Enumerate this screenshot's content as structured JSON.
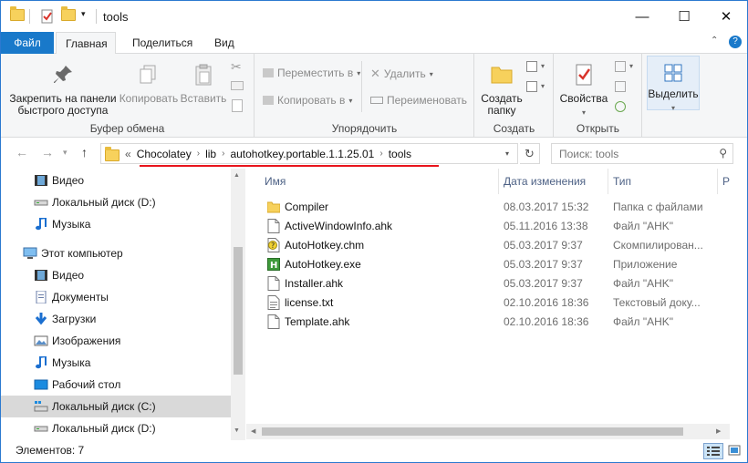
{
  "window": {
    "title": "tools",
    "minimize_glyph": "—",
    "maximize_glyph": "☐",
    "close_glyph": "✕"
  },
  "ribbon_tabs": [
    {
      "label": "Файл"
    },
    {
      "label": "Главная"
    },
    {
      "label": "Поделиться"
    },
    {
      "label": "Вид"
    }
  ],
  "ribbon": {
    "clipboard": {
      "pin": "Закрепить на панели быстрого доступа",
      "copy": "Копировать",
      "paste": "Вставить",
      "label": "Буфер обмена"
    },
    "organize": {
      "move_to": "Переместить в",
      "copy_to": "Копировать в",
      "delete": "Удалить",
      "rename": "Переименовать",
      "label": "Упорядочить"
    },
    "create": {
      "new_folder": "Создать папку",
      "label": "Создать"
    },
    "open": {
      "properties": "Свойства",
      "label": "Открыть"
    },
    "select": {
      "select": "Выделить"
    }
  },
  "address": {
    "overflow": "«",
    "crumbs": [
      "Chocolatey",
      "lib",
      "autohotkey.portable.1.1.25.01",
      "tools"
    ]
  },
  "search": {
    "placeholder": "Поиск: tools"
  },
  "nav": [
    {
      "label": "Видео",
      "icon": "video-icon",
      "indent": 36
    },
    {
      "label": "Локальный диск (D:)",
      "icon": "drive-icon",
      "indent": 36
    },
    {
      "label": "Музыка",
      "icon": "music-icon",
      "indent": 36
    },
    {
      "label": "Этот компьютер",
      "icon": "computer-icon",
      "indent": 24
    },
    {
      "label": "Видео",
      "icon": "video-icon",
      "indent": 36
    },
    {
      "label": "Документы",
      "icon": "documents-icon",
      "indent": 36
    },
    {
      "label": "Загрузки",
      "icon": "downloads-icon",
      "indent": 36
    },
    {
      "label": "Изображения",
      "icon": "pictures-icon",
      "indent": 36
    },
    {
      "label": "Музыка",
      "icon": "music-icon",
      "indent": 36
    },
    {
      "label": "Рабочий стол",
      "icon": "desktop-icon",
      "indent": 36
    },
    {
      "label": "Локальный диск (C:)",
      "icon": "system-drive-icon",
      "indent": 36,
      "selected": true
    },
    {
      "label": "Локальный диск (D:)",
      "icon": "drive-icon",
      "indent": 36
    }
  ],
  "columns": {
    "name": "Имя",
    "date": "Дата изменения",
    "type": "Тип",
    "size": "Разм"
  },
  "files": [
    {
      "name": "Compiler",
      "date": "08.03.2017 15:32",
      "type": "Папка с файлами",
      "icon": "folder-icon"
    },
    {
      "name": "ActiveWindowInfo.ahk",
      "date": "05.11.2016 13:38",
      "type": "Файл \"AHK\"",
      "icon": "file-icon"
    },
    {
      "name": "AutoHotkey.chm",
      "date": "05.03.2017 9:37",
      "type": "Скомпилирован...",
      "icon": "help-file-icon"
    },
    {
      "name": "AutoHotkey.exe",
      "date": "05.03.2017 9:37",
      "type": "Приложение",
      "icon": "autohotkey-exe-icon"
    },
    {
      "name": "Installer.ahk",
      "date": "05.03.2017 9:37",
      "type": "Файл \"AHK\"",
      "icon": "file-icon"
    },
    {
      "name": "license.txt",
      "date": "02.10.2016 18:36",
      "type": "Текстовый доку...",
      "icon": "text-file-icon"
    },
    {
      "name": "Template.ahk",
      "date": "02.10.2016 18:36",
      "type": "Файл \"AHK\"",
      "icon": "file-icon"
    }
  ],
  "status": {
    "count": "Элементов: 7"
  }
}
